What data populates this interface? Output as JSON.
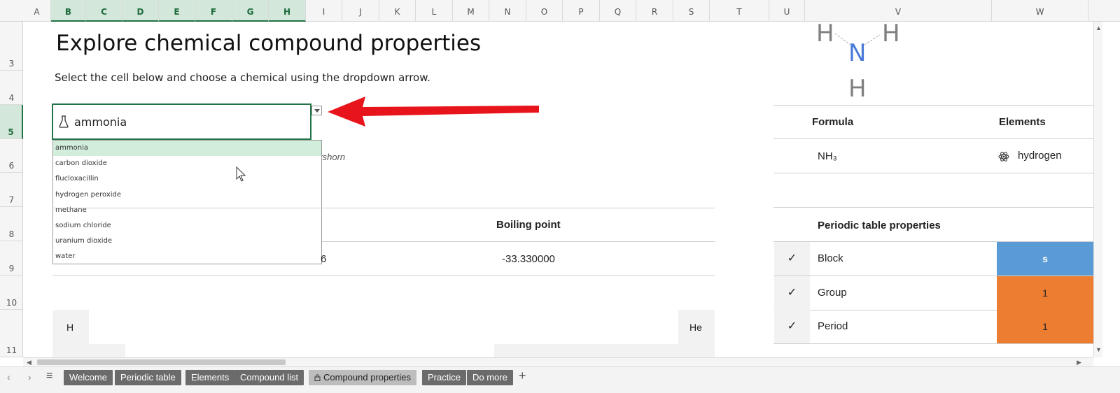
{
  "columns": [
    {
      "label": "A",
      "w": 40
    },
    {
      "label": "B",
      "w": 50,
      "sel": true
    },
    {
      "label": "C",
      "w": 52,
      "sel": true
    },
    {
      "label": "D",
      "w": 52,
      "sel": true
    },
    {
      "label": "E",
      "w": 52,
      "sel": true
    },
    {
      "label": "F",
      "w": 53,
      "sel": true
    },
    {
      "label": "G",
      "w": 52,
      "sel": true
    },
    {
      "label": "H",
      "w": 53,
      "sel": true
    },
    {
      "label": "I",
      "w": 52
    },
    {
      "label": "J",
      "w": 53
    },
    {
      "label": "K",
      "w": 52
    },
    {
      "label": "L",
      "w": 53
    },
    {
      "label": "M",
      "w": 52
    },
    {
      "label": "N",
      "w": 53
    },
    {
      "label": "O",
      "w": 52
    },
    {
      "label": "P",
      "w": 53
    },
    {
      "label": "Q",
      "w": 52
    },
    {
      "label": "R",
      "w": 53
    },
    {
      "label": "S",
      "w": 52
    },
    {
      "label": "T",
      "w": 85
    },
    {
      "label": "U",
      "w": 51
    },
    {
      "label": "V",
      "w": 267
    },
    {
      "label": "W",
      "w": 138
    }
  ],
  "rows": [
    "3",
    "4",
    "5",
    "6",
    "7",
    "8",
    "9",
    "10",
    "11"
  ],
  "selected_row": "5",
  "sheet": {
    "title": "Explore chemical compound properties",
    "subtitle": "Select the cell below and choose a chemical using the dropdown arrow.",
    "selected_chemical": "ammonia",
    "dropdown_options": [
      "ammonia",
      "carbon dioxide",
      "flucloxacillin",
      "hydrogen peroxide",
      "methane",
      "sodium chloride",
      "uranium dioxide",
      "water"
    ],
    "partial_text": "tshorn",
    "boiling_point_header": "Boiling point",
    "boiling_point_value": "-33.330000",
    "partial_value": "6",
    "pt_h": "H",
    "pt_he": "He"
  },
  "structure": {
    "h_left": "H",
    "n": "N",
    "h_right": "H",
    "h_bottom": "H"
  },
  "info": {
    "formula_header": "Formula",
    "elements_header": "Elements",
    "formula_value": "NH₃",
    "element_value": "hydrogen",
    "pt_properties_header": "Periodic table properties",
    "properties": [
      {
        "check": "✓",
        "label": "Block",
        "value": "s",
        "color": "#5b9bd5"
      },
      {
        "check": "✓",
        "label": "Group",
        "value": "1",
        "color": "#ed7d31"
      },
      {
        "check": "✓",
        "label": "Period",
        "value": "1",
        "color": "#ed7d31"
      }
    ]
  },
  "tabs": [
    "Welcome",
    "Periodic table",
    "Elements",
    "Compound list",
    "Compound properties",
    "Practice",
    "Do more"
  ],
  "active_tab": "Compound properties",
  "add_sheet": "+",
  "colors": {
    "accent_green": "#217346",
    "arrow_red": "#e8141b",
    "nitrogen_blue": "#4a7bd8"
  }
}
